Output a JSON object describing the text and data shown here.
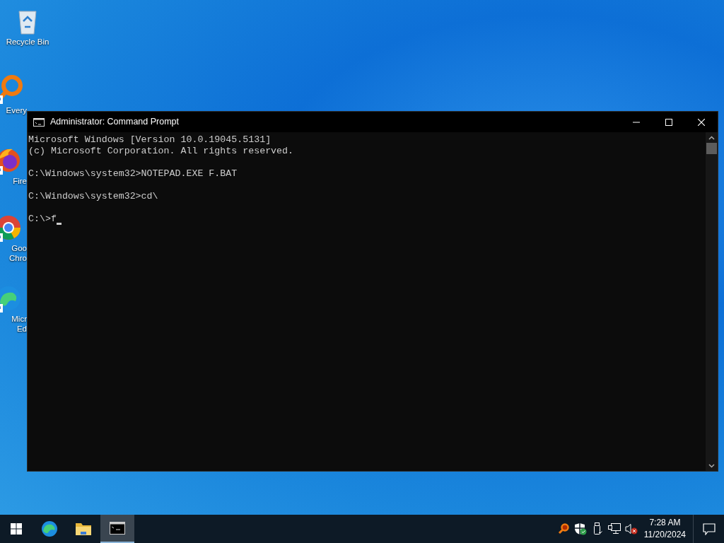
{
  "desktop_icons": [
    {
      "kind": "recycle",
      "lines": [
        "Recycle Bin"
      ],
      "shortcut": false
    },
    {
      "kind": "search",
      "lines": [
        "Every"
      ],
      "shortcut": true
    },
    {
      "kind": "firefox",
      "lines": [
        "Fire"
      ],
      "shortcut": true
    },
    {
      "kind": "chrome",
      "lines": [
        "Goo",
        "Chro"
      ],
      "shortcut": true
    },
    {
      "kind": "edge",
      "lines": [
        "Micr",
        "Ed"
      ],
      "shortcut": true
    }
  ],
  "window": {
    "title": "Administrator: Command Prompt",
    "blocks": [
      [
        "Microsoft Windows [Version 10.0.19045.5131]",
        "(c) Microsoft Corporation. All rights reserved."
      ],
      [
        "C:\\Windows\\system32>NOTEPAD.EXE F.BAT"
      ],
      [
        "C:\\Windows\\system32>cd\\"
      ],
      [
        "C:\\>f"
      ]
    ],
    "cursor": true
  },
  "taskbar": {
    "apps": [
      {
        "kind": "start",
        "selected": false
      },
      {
        "kind": "edge",
        "selected": false
      },
      {
        "kind": "folder",
        "selected": false
      },
      {
        "kind": "console",
        "selected": true
      }
    ],
    "tray": [
      {
        "kind": "search"
      },
      {
        "kind": "shield"
      },
      {
        "kind": "usb"
      },
      {
        "kind": "network"
      },
      {
        "kind": "muted"
      }
    ],
    "time": "7:28 AM",
    "date": "11/20/2024"
  }
}
